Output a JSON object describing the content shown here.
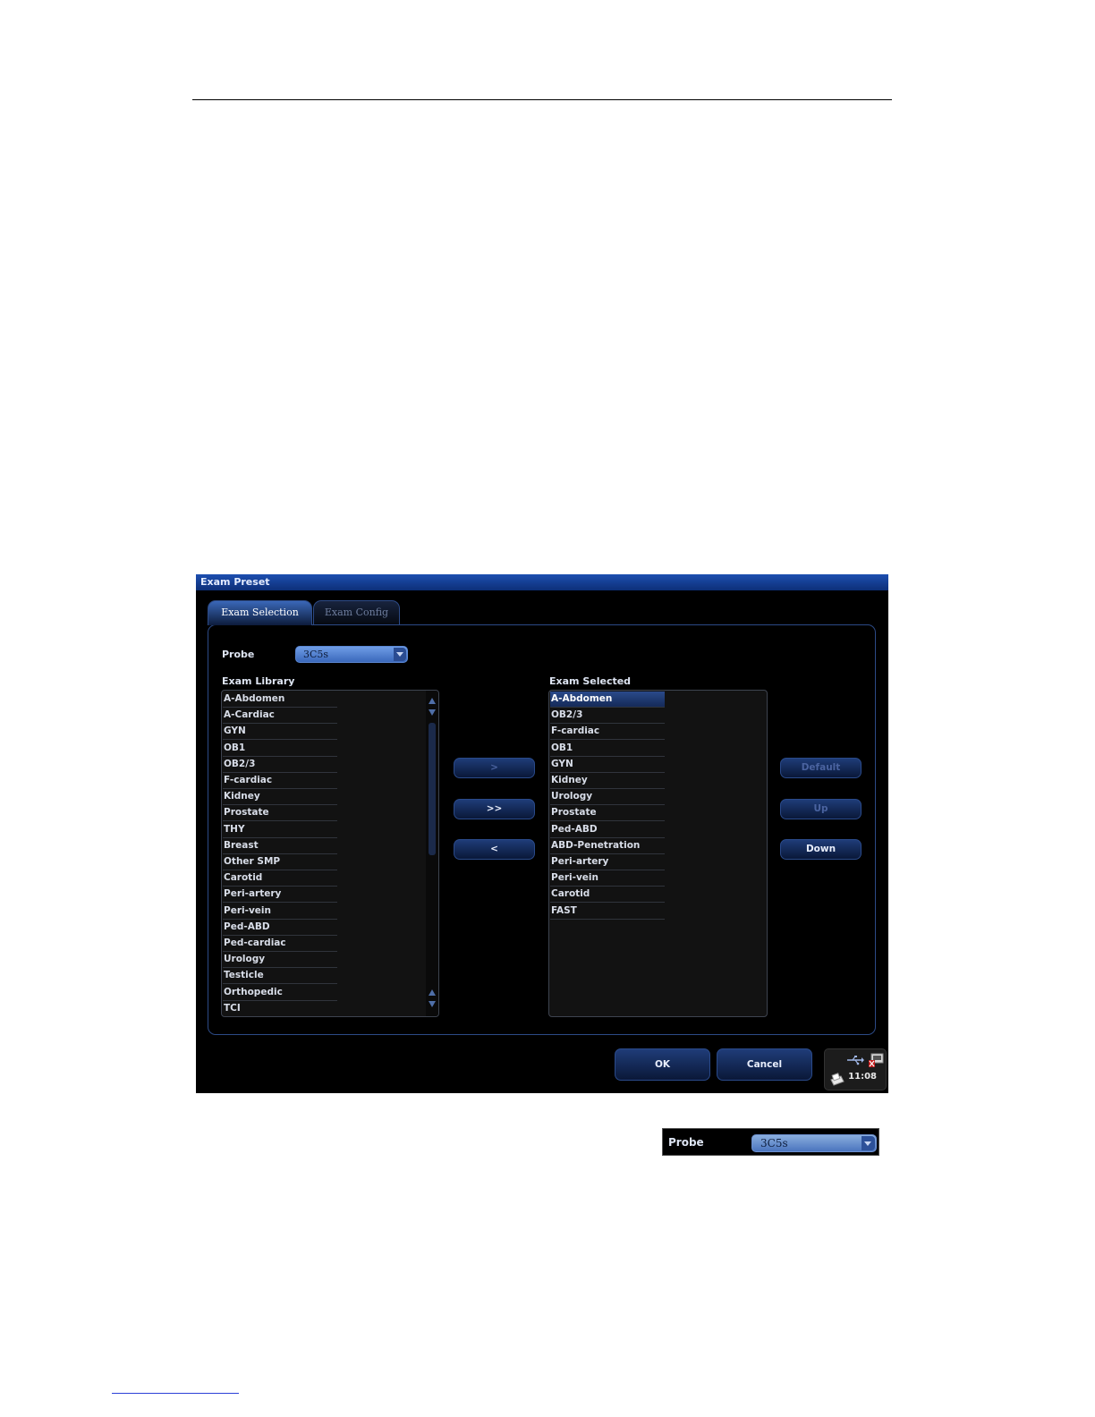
{
  "dialog": {
    "title": "Exam Preset",
    "tabs": [
      {
        "label": "Exam Selection",
        "active": true
      },
      {
        "label": "Exam Config",
        "active": false
      }
    ],
    "probe": {
      "label": "Probe",
      "value": "3C5s"
    },
    "library": {
      "heading": "Exam Library",
      "items": [
        "A-Abdomen",
        "A-Cardiac",
        "GYN",
        "OB1",
        "OB2/3",
        "F-cardiac",
        "Kidney",
        "Prostate",
        "THY",
        "Breast",
        "Other SMP",
        "Carotid",
        "Peri-artery",
        "Peri-vein",
        "Ped-ABD",
        "Ped-cardiac",
        "Urology",
        "Testicle",
        "Orthopedic",
        "TCI"
      ]
    },
    "selected": {
      "heading": "Exam Selected",
      "highlighted": "A-Abdomen",
      "items": [
        "A-Abdomen",
        "OB2/3",
        "F-cardiac",
        "OB1",
        "GYN",
        "Kidney",
        "Urology",
        "Prostate",
        "Ped-ABD",
        "ABD-Penetration",
        "Peri-artery",
        "Peri-vein",
        "Carotid",
        "FAST"
      ]
    },
    "transfer_buttons": {
      "add": ">",
      "add_all": ">>",
      "remove": "<"
    },
    "order_buttons": {
      "default": "Default",
      "up": "Up",
      "down": "Down"
    },
    "ok_label": "OK",
    "cancel_label": "Cancel",
    "status": {
      "time": "11:08",
      "icons": [
        "usb-icon",
        "disk-icon",
        "printer-icon"
      ]
    }
  },
  "probe_inset": {
    "label": "Probe",
    "value": "3C5s"
  },
  "colors": {
    "accent": "#3a68bb",
    "background": "#000000",
    "title_bar": "#1d4fb0"
  }
}
